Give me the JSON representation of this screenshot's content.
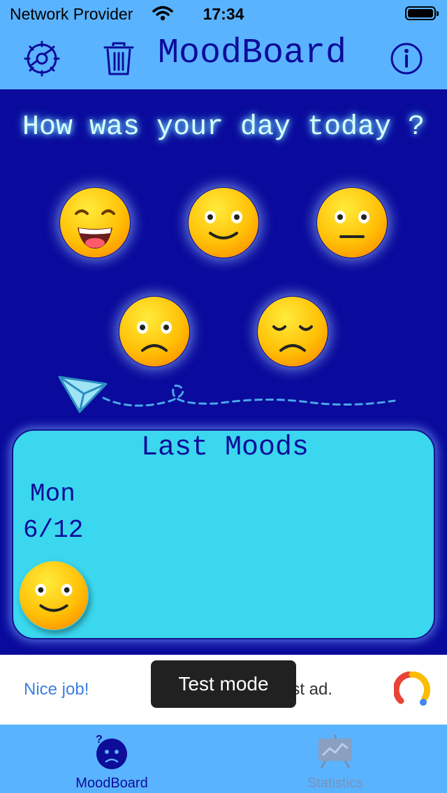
{
  "status_bar": {
    "carrier": "Network Provider",
    "time": "17:34"
  },
  "header": {
    "title": "MoodBoard",
    "settings_icon": "gear-icon",
    "delete_icon": "trash-icon",
    "info_icon": "info-icon"
  },
  "prompt": "How was your day today ?",
  "moods": [
    "grinning",
    "smiling",
    "neutral",
    "frowning",
    "sad"
  ],
  "last_moods": {
    "title": "Last Moods",
    "entries": [
      {
        "day": "Mon",
        "date": "6/12",
        "mood": "smiling"
      }
    ]
  },
  "ad": {
    "text_left": "Nice job!",
    "text_right": "est ad."
  },
  "toast": "Test mode",
  "tabs": [
    {
      "label": "MoodBoard",
      "icon": "mood-face-icon",
      "active": true
    },
    {
      "label": "Statistics",
      "icon": "chart-icon",
      "active": false
    }
  ],
  "colors": {
    "background": "#0a0a9c",
    "bar": "#5ab3ff",
    "card": "#3ad7ee",
    "accent": "#0d0d9a"
  }
}
